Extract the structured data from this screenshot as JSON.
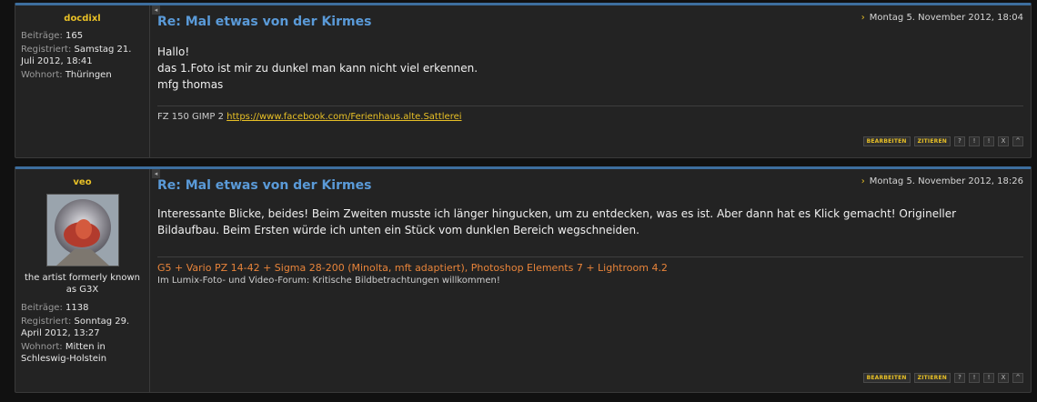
{
  "posts": [
    {
      "username": "docdixl",
      "fields": [
        {
          "label": "Beiträge:",
          "value": "165"
        },
        {
          "label": "Registriert:",
          "value": "Samstag 21. Juli 2012, 18:41"
        },
        {
          "label": "Wohnort:",
          "value": "Thüringen"
        }
      ],
      "title": "Re: Mal etwas von der Kirmes",
      "date": "Montag 5. November 2012, 18:04",
      "body": [
        "Hallo!",
        "das 1.Foto ist mir zu dunkel man kann nicht viel erkennen.",
        "mfg thomas"
      ],
      "signature": {
        "text": "FZ 150 GIMP 2",
        "link": "https://www.facebook.com/Ferienhaus.alte.Sattlerei"
      },
      "buttons": {
        "edit": "BEARBEITEN",
        "quote": "ZITIEREN",
        "icons": [
          "?",
          "!",
          "!",
          "X",
          "^"
        ]
      }
    },
    {
      "username": "veo",
      "rank": "the artist formerly known as G3X",
      "fields": [
        {
          "label": "Beiträge:",
          "value": "1138"
        },
        {
          "label": "Registriert:",
          "value": "Sonntag 29. April 2012, 13:27"
        },
        {
          "label": "Wohnort:",
          "value": "Mitten in Schleswig-Holstein"
        }
      ],
      "title": "Re: Mal etwas von der Kirmes",
      "date": "Montag 5. November 2012, 18:26",
      "body": [
        "Interessante Blicke, beides! Beim Zweiten musste ich länger hingucken, um zu entdecken, was es ist. Aber dann hat es Klick gemacht! Origineller Bildaufbau. Beim Ersten würde ich unten ein Stück vom dunklen Bereich wegschneiden."
      ],
      "signature": {
        "line1": "G5 + Vario PZ 14-42 + Sigma 28-200 (Minolta, mft adaptiert), Photoshop Elements 7 + Lightroom 4.2",
        "line2": "Im Lumix-Foto- und Video-Forum: Kritische Bildbetrachtungen willkommen!"
      },
      "buttons": {
        "edit": "BEARBEITEN",
        "quote": "ZITIEREN",
        "icons": [
          "?",
          "!",
          "!",
          "X",
          "^"
        ]
      }
    }
  ],
  "colors": {
    "accent": "#5a9ad8",
    "username": "#e8c026",
    "sig_orange": "#e8843a"
  }
}
